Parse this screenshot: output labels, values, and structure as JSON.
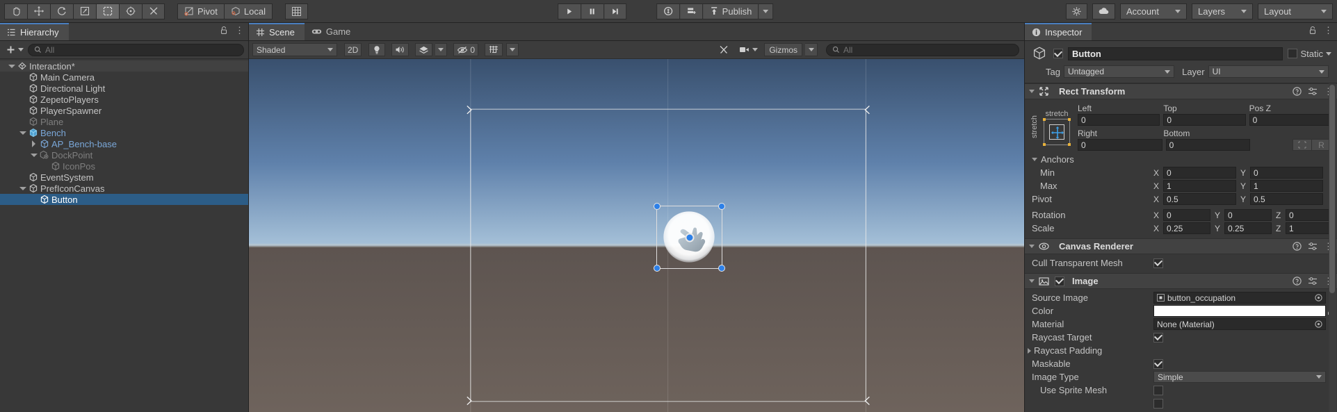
{
  "toolbar": {
    "tools": [
      {
        "name": "hand-tool",
        "label": "",
        "active": false
      },
      {
        "name": "move-tool",
        "label": "",
        "active": false
      },
      {
        "name": "rotate-tool",
        "label": "",
        "active": false
      },
      {
        "name": "scale-tool",
        "label": "",
        "active": false
      },
      {
        "name": "rect-tool",
        "label": "",
        "active": true
      },
      {
        "name": "transform-tool",
        "label": "",
        "active": false
      },
      {
        "name": "custom-editor-tool",
        "label": "",
        "active": false
      }
    ],
    "pivot_label": "Pivot",
    "handle_label": "Local",
    "grid_label": "",
    "play_label": "",
    "pause_label": "",
    "step_label": "",
    "collab_label": "",
    "services_label": "",
    "publish_label": "Publish",
    "account_label": "Account",
    "layers_label": "Layers",
    "layout_label": "Layout"
  },
  "hierarchy": {
    "tab_label": "Hierarchy",
    "add_label": "",
    "search_placeholder": "All",
    "items": [
      {
        "label": "Interaction*",
        "depth": 0,
        "arrow": "open",
        "icon": "scene-icon",
        "state": "header"
      },
      {
        "label": "Main Camera",
        "depth": 1,
        "arrow": "none",
        "icon": "gameobject-icon",
        "state": "normal"
      },
      {
        "label": "Directional Light",
        "depth": 1,
        "arrow": "none",
        "icon": "gameobject-icon",
        "state": "normal"
      },
      {
        "label": "ZepetoPlayers",
        "depth": 1,
        "arrow": "none",
        "icon": "gameobject-icon",
        "state": "normal"
      },
      {
        "label": "PlayerSpawner",
        "depth": 1,
        "arrow": "none",
        "icon": "gameobject-icon",
        "state": "normal"
      },
      {
        "label": "Plane",
        "depth": 1,
        "arrow": "none",
        "icon": "gameobject-icon",
        "state": "dim"
      },
      {
        "label": "Bench",
        "depth": 1,
        "arrow": "open",
        "icon": "prefab-icon",
        "state": "prefab"
      },
      {
        "label": "AP_Bench-base",
        "depth": 2,
        "arrow": "closed",
        "icon": "gameobject-icon",
        "state": "prefab"
      },
      {
        "label": "DockPoint",
        "depth": 2,
        "arrow": "open",
        "icon": "prefab-variant-icon",
        "state": "dim"
      },
      {
        "label": "IconPos",
        "depth": 3,
        "arrow": "none",
        "icon": "gameobject-icon",
        "state": "dim"
      },
      {
        "label": "EventSystem",
        "depth": 1,
        "arrow": "none",
        "icon": "gameobject-icon",
        "state": "normal"
      },
      {
        "label": "PrefIconCanvas",
        "depth": 1,
        "arrow": "open",
        "icon": "gameobject-icon",
        "state": "normal"
      },
      {
        "label": "Button",
        "depth": 2,
        "arrow": "none",
        "icon": "gameobject-icon",
        "state": "selected"
      }
    ]
  },
  "scene": {
    "tabs": [
      {
        "label": "Scene",
        "icon": "scene-grid-icon",
        "active": true
      },
      {
        "label": "Game",
        "icon": "gamepad-icon",
        "active": false
      }
    ],
    "draw_mode": "Shaded",
    "mode_2d": "2D",
    "lighting_label": "",
    "audio_label": "",
    "fx_label": "",
    "hidden_count": "0",
    "grid_label": "",
    "gizmos_label": "Gizmos",
    "search_placeholder": "All"
  },
  "inspector": {
    "tab_label": "Inspector",
    "object_name": "Button",
    "enabled": true,
    "static_label": "Static",
    "tag_label": "Tag",
    "tag_value": "Untagged",
    "layer_label": "Layer",
    "layer_value": "UI",
    "components": [
      {
        "title": "Rect Transform",
        "anchor_preset_label": "stretch",
        "anchor_preset_side_label": "stretch",
        "fields": {
          "left_label": "Left",
          "left_value": "0",
          "top_label": "Top",
          "top_value": "0",
          "posz_label": "Pos Z",
          "posz_value": "0",
          "right_label": "Right",
          "right_value": "0",
          "bottom_label": "Bottom",
          "bottom_value": "0",
          "blueprint_label": "",
          "raw_label": "R",
          "anchors_label": "Anchors",
          "min_label": "Min",
          "min_x": "0",
          "min_y": "0",
          "max_label": "Max",
          "max_x": "1",
          "max_y": "1",
          "pivot_label": "Pivot",
          "pivot_x": "0.5",
          "pivot_y": "0.5",
          "rotation_label": "Rotation",
          "rot_x": "0",
          "rot_y": "0",
          "rot_z": "0",
          "scale_label": "Scale",
          "scale_x": "0.25",
          "scale_y": "0.25",
          "scale_z": "1",
          "axis_x": "X",
          "axis_y": "Y",
          "axis_z": "Z"
        }
      },
      {
        "title": "Canvas Renderer",
        "cull_label": "Cull Transparent Mesh",
        "cull_checked": true
      },
      {
        "title": "Image",
        "source_image_label": "Source Image",
        "source_image_value": "button_occupation",
        "color_label": "Color",
        "color_value": "#FFFFFF",
        "material_label": "Material",
        "material_value": "None (Material)",
        "raycast_target_label": "Raycast Target",
        "raycast_target_checked": true,
        "raycast_padding_label": "Raycast Padding",
        "maskable_label": "Maskable",
        "maskable_checked": true,
        "image_type_label": "Image Type",
        "image_type_value": "Simple",
        "use_sprite_mesh_label": "Use Sprite Mesh",
        "use_sprite_mesh_checked": false
      }
    ]
  },
  "colors": {
    "selection_blue": "#2c5d87",
    "accent_blue": "#4a7fbf",
    "panel_bg": "#383838",
    "toolbar_bg": "#3c3c3c",
    "prefab_blue": "#7aa7d8"
  }
}
